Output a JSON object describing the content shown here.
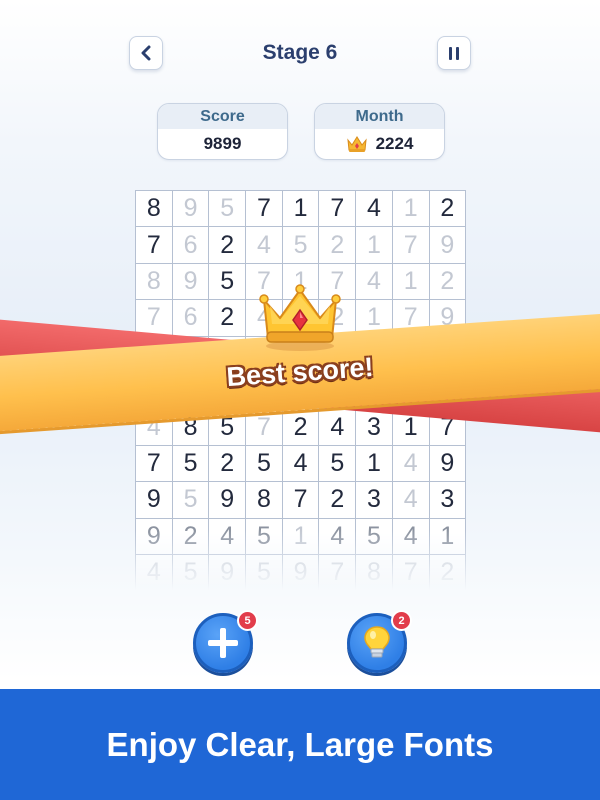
{
  "header": {
    "title": "Stage 6"
  },
  "stats": {
    "score": {
      "label": "Score",
      "value": "9899"
    },
    "month": {
      "label": "Month",
      "value": "2224"
    }
  },
  "grid": {
    "columns": 9,
    "rows": [
      [
        [
          "8",
          "d"
        ],
        [
          "9",
          "l"
        ],
        [
          "5",
          "l"
        ],
        [
          "7",
          "d"
        ],
        [
          "1",
          "d"
        ],
        [
          "7",
          "d"
        ],
        [
          "4",
          "d"
        ],
        [
          "1",
          "l"
        ],
        [
          "2",
          "d"
        ]
      ],
      [
        [
          "7",
          "d"
        ],
        [
          "6",
          "l"
        ],
        [
          "2",
          "d"
        ],
        [
          "4",
          "l"
        ],
        [
          "5",
          "l"
        ],
        [
          "2",
          "l"
        ],
        [
          "1",
          "l"
        ],
        [
          "7",
          "l"
        ],
        [
          "9",
          "l"
        ]
      ],
      [
        [
          "8",
          "l"
        ],
        [
          "9",
          "l"
        ],
        [
          "5",
          "d"
        ],
        [
          "7",
          "l"
        ],
        [
          "1",
          "l"
        ],
        [
          "7",
          "l"
        ],
        [
          "4",
          "l"
        ],
        [
          "1",
          "l"
        ],
        [
          "2",
          "l"
        ]
      ],
      [
        [
          "7",
          "l"
        ],
        [
          "6",
          "l"
        ],
        [
          "2",
          "d"
        ],
        [
          "4",
          "l"
        ],
        [
          "5",
          "l"
        ],
        [
          "2",
          "l"
        ],
        [
          "1",
          "l"
        ],
        [
          "7",
          "l"
        ],
        [
          "9",
          "l"
        ]
      ],
      [
        [
          "",
          "l"
        ],
        [
          "",
          "l"
        ],
        [
          "",
          "l"
        ],
        [
          "",
          "l"
        ],
        [
          "",
          "l"
        ],
        [
          "",
          "l"
        ],
        [
          "",
          "l"
        ],
        [
          "",
          "l"
        ],
        [
          "",
          "l"
        ]
      ],
      [
        [
          "",
          "l"
        ],
        [
          "",
          "l"
        ],
        [
          "",
          "l"
        ],
        [
          "",
          "l"
        ],
        [
          "",
          "l"
        ],
        [
          "",
          "l"
        ],
        [
          "",
          "l"
        ],
        [
          "",
          "l"
        ],
        [
          "",
          "l"
        ]
      ],
      [
        [
          "4",
          "l"
        ],
        [
          "8",
          "d"
        ],
        [
          "5",
          "d"
        ],
        [
          "7",
          "l"
        ],
        [
          "2",
          "d"
        ],
        [
          "4",
          "d"
        ],
        [
          "3",
          "d"
        ],
        [
          "1",
          "d"
        ],
        [
          "7",
          "d"
        ]
      ],
      [
        [
          "7",
          "d"
        ],
        [
          "5",
          "d"
        ],
        [
          "2",
          "d"
        ],
        [
          "5",
          "d"
        ],
        [
          "4",
          "d"
        ],
        [
          "5",
          "d"
        ],
        [
          "1",
          "d"
        ],
        [
          "4",
          "l"
        ],
        [
          "9",
          "d"
        ]
      ],
      [
        [
          "9",
          "d"
        ],
        [
          "5",
          "l"
        ],
        [
          "9",
          "d"
        ],
        [
          "8",
          "d"
        ],
        [
          "7",
          "d"
        ],
        [
          "2",
          "d"
        ],
        [
          "3",
          "d"
        ],
        [
          "4",
          "l"
        ],
        [
          "3",
          "d"
        ]
      ],
      [
        [
          "9",
          "m"
        ],
        [
          "2",
          "m"
        ],
        [
          "4",
          "m"
        ],
        [
          "5",
          "m"
        ],
        [
          "1",
          "l"
        ],
        [
          "4",
          "m"
        ],
        [
          "5",
          "m"
        ],
        [
          "4",
          "m"
        ],
        [
          "1",
          "m"
        ]
      ],
      [
        [
          "4",
          "l"
        ],
        [
          "5",
          "l"
        ],
        [
          "9",
          "l"
        ],
        [
          "5",
          "l"
        ],
        [
          "9",
          "l"
        ],
        [
          "7",
          "l"
        ],
        [
          "8",
          "l"
        ],
        [
          "7",
          "l"
        ],
        [
          "2",
          "l"
        ]
      ]
    ]
  },
  "banner": {
    "text": "Best score!"
  },
  "tools": {
    "add": {
      "badge": "5"
    },
    "hint": {
      "badge": "2"
    }
  },
  "footer": {
    "text": "Enjoy Clear, Large Fonts"
  },
  "colors": {
    "accent": "#1f67d6",
    "title": "#2b3f6e",
    "banner_gold": "#ffc04d",
    "banner_red": "#e44f4f",
    "badge": "#e23d4b"
  }
}
